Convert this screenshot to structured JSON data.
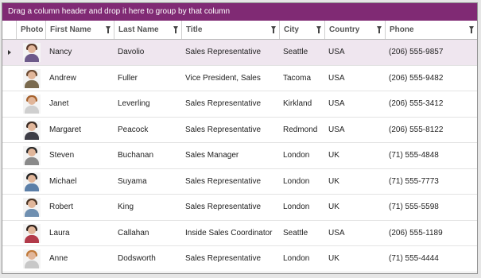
{
  "group_panel": {
    "text": "Drag a column header and drop it here to group by that column",
    "bg": "#802a74"
  },
  "columns": [
    {
      "key": "photo",
      "label": "Photo",
      "filter": false
    },
    {
      "key": "first",
      "label": "First Name",
      "filter": true
    },
    {
      "key": "last",
      "label": "Last Name",
      "filter": true
    },
    {
      "key": "title",
      "label": "Title",
      "filter": true
    },
    {
      "key": "city",
      "label": "City",
      "filter": true
    },
    {
      "key": "country",
      "label": "Country",
      "filter": true
    },
    {
      "key": "phone",
      "label": "Phone",
      "filter": true
    }
  ],
  "rows": [
    {
      "first": "Nancy",
      "last": "Davolio",
      "title": "Sales Representative",
      "city": "Seattle",
      "country": "USA",
      "phone": "(206) 555-9857",
      "selected": true,
      "photo": {
        "hair": "#5a3a2a",
        "body": "#6d5a8a"
      }
    },
    {
      "first": "Andrew",
      "last": "Fuller",
      "title": "Vice President, Sales",
      "city": "Tacoma",
      "country": "USA",
      "phone": "(206) 555-9482",
      "selected": false,
      "photo": {
        "hair": "#6b4a32",
        "body": "#7a6a4e"
      }
    },
    {
      "first": "Janet",
      "last": "Leverling",
      "title": "Sales Representative",
      "city": "Kirkland",
      "country": "USA",
      "phone": "(206) 555-3412",
      "selected": false,
      "photo": {
        "hair": "#a6622e",
        "body": "#cfcfcf"
      }
    },
    {
      "first": "Margaret",
      "last": "Peacock",
      "title": "Sales Representative",
      "city": "Redmond",
      "country": "USA",
      "phone": "(206) 555-8122",
      "selected": false,
      "photo": {
        "hair": "#3a2a22",
        "body": "#3d3d46"
      }
    },
    {
      "first": "Steven",
      "last": "Buchanan",
      "title": "Sales Manager",
      "city": "London",
      "country": "UK",
      "phone": "(71) 555-4848",
      "selected": false,
      "photo": {
        "hair": "#2a2a2a",
        "body": "#8a8a8a"
      }
    },
    {
      "first": "Michael",
      "last": "Suyama",
      "title": "Sales Representative",
      "city": "London",
      "country": "UK",
      "phone": "(71) 555-7773",
      "selected": false,
      "photo": {
        "hair": "#222222",
        "body": "#5b7fa8"
      }
    },
    {
      "first": "Robert",
      "last": "King",
      "title": "Sales Representative",
      "city": "London",
      "country": "UK",
      "phone": "(71) 555-5598",
      "selected": false,
      "photo": {
        "hair": "#4a3424",
        "body": "#6f8fb0"
      }
    },
    {
      "first": "Laura",
      "last": "Callahan",
      "title": "Inside Sales Coordinator",
      "city": "Seattle",
      "country": "USA",
      "phone": "(206) 555-1189",
      "selected": false,
      "photo": {
        "hair": "#2e211a",
        "body": "#b23a4a"
      }
    },
    {
      "first": "Anne",
      "last": "Dodsworth",
      "title": "Sales Representative",
      "city": "London",
      "country": "UK",
      "phone": "(71) 555-4444",
      "selected": false,
      "photo": {
        "hair": "#c07a3a",
        "body": "#c8c8c8"
      }
    }
  ]
}
